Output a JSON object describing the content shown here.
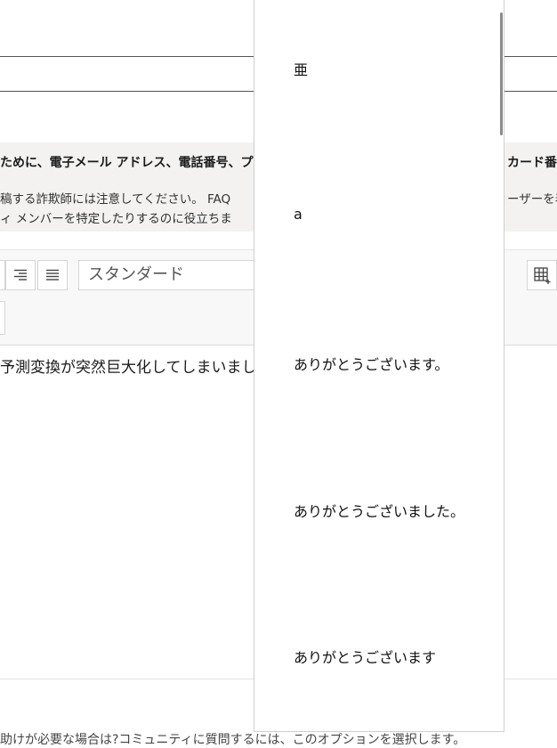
{
  "notice": {
    "title_left": "ために、電子メール アドレス、電話番号、プ",
    "title_right": "カード番",
    "line1_left": "稿する詐欺師には注意してください。 FAQ",
    "line1_right": "ーザーを表",
    "line2_left": "ィ メンバーを特定したりするのに役立ちま"
  },
  "toolbar": {
    "style_select_value": "スタンダード"
  },
  "editor": {
    "body_text": "予測変換が突然巨大化してしまいまし"
  },
  "footer": {
    "text": "助けが必要な場合は?コミュニティに質問するには、このオプションを選択します。"
  },
  "ime": {
    "candidates": [
      "亜",
      "a",
      "ありがとうございます。",
      "ありがとうございました。",
      "ありがとうございます"
    ]
  }
}
